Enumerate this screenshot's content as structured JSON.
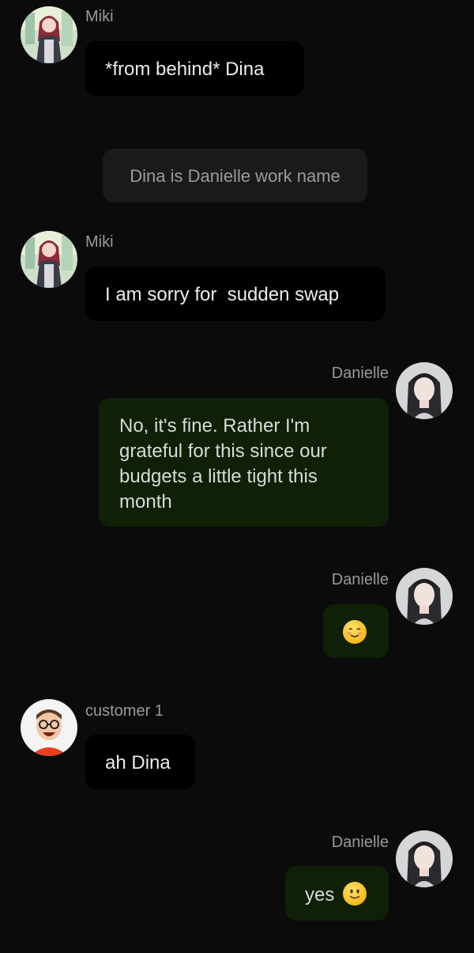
{
  "messages": [
    {
      "sender": "Miki",
      "text": "*from behind* Dina",
      "side": "left",
      "avatar": "miki-avatar-icon"
    },
    {
      "system": "Dina is Danielle work name"
    },
    {
      "sender": "Miki",
      "text": "I am sorry for  sudden swap",
      "side": "left",
      "avatar": "miki-avatar-icon"
    },
    {
      "sender": "Danielle",
      "text_lines": [
        "No, it's fine. Rather I'm",
        "grateful for this since our",
        "budgets a little tight this",
        "month"
      ],
      "side": "right",
      "avatar": "danielle-avatar-icon"
    },
    {
      "sender": "Danielle",
      "emoji": "smiling-blush-emoji-icon",
      "side": "right",
      "avatar": "danielle-avatar-icon"
    },
    {
      "sender": "customer 1",
      "text": "ah Dina",
      "side": "left",
      "avatar": "customer-avatar-icon"
    },
    {
      "sender": "Danielle",
      "text": "yes",
      "emoji": "slight-smile-emoji-icon",
      "side": "right",
      "avatar": "danielle-avatar-icon"
    }
  ],
  "colors": {
    "background": "#0b0b0b",
    "incoming_bubble": "#000000",
    "outgoing_bubble": "#0f2006",
    "system_bubble": "#1a1a1a",
    "name_text": "#9a9a9a"
  }
}
